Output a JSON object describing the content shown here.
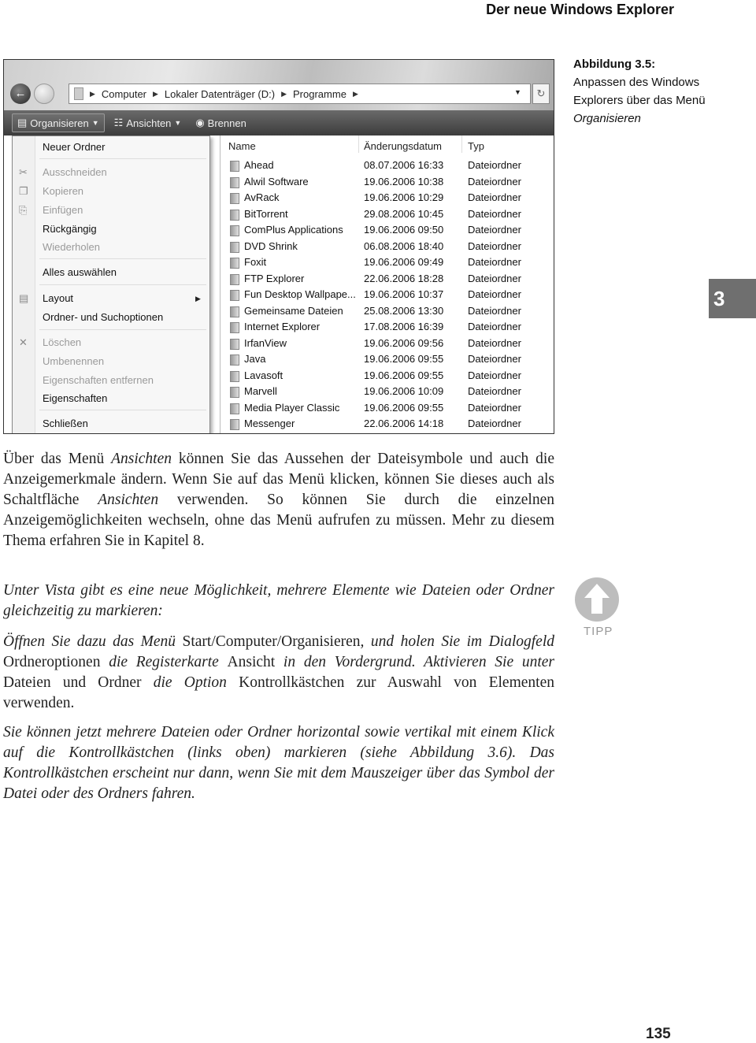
{
  "header": {
    "running_title": "Der neue Windows Explorer"
  },
  "caption": {
    "label": "Abbildung 3.5:",
    "text": "Anpassen des Windows Explorers über das Menü",
    "menu": "Organisieren"
  },
  "chapter_tab": "3",
  "page_number": "135",
  "explorer": {
    "breadcrumb": [
      "Computer",
      "Lokaler Datenträger (D:)",
      "Programme"
    ],
    "toolbar": {
      "organize": "Organisieren",
      "views": "Ansichten",
      "burn": "Brennen"
    },
    "menu": [
      {
        "label": "Neuer Ordner",
        "enabled": true
      },
      {
        "label": "Ausschneiden",
        "enabled": false,
        "icon": "scissors-icon"
      },
      {
        "label": "Kopieren",
        "enabled": false,
        "icon": "copy-icon"
      },
      {
        "label": "Einfügen",
        "enabled": false,
        "icon": "paste-icon"
      },
      {
        "label": "Rückgängig",
        "enabled": true
      },
      {
        "label": "Wiederholen",
        "enabled": false
      },
      {
        "label": "Alles auswählen",
        "enabled": true
      },
      {
        "label": "Layout",
        "enabled": true,
        "icon": "layout-icon",
        "submenu": true
      },
      {
        "label": "Ordner- und Suchoptionen",
        "enabled": true
      },
      {
        "label": "Löschen",
        "enabled": false,
        "icon": "delete-x-icon"
      },
      {
        "label": "Umbenennen",
        "enabled": false
      },
      {
        "label": "Eigenschaften entfernen",
        "enabled": false
      },
      {
        "label": "Eigenschaften",
        "enabled": true
      },
      {
        "label": "Schließen",
        "enabled": true
      }
    ],
    "columns": [
      "Name",
      "Änderungsdatum",
      "Typ"
    ],
    "files": [
      [
        "Ahead",
        "08.07.2006 16:33",
        "Dateiordner"
      ],
      [
        "Alwil Software",
        "19.06.2006 10:38",
        "Dateiordner"
      ],
      [
        "AvRack",
        "19.06.2006 10:29",
        "Dateiordner"
      ],
      [
        "BitTorrent",
        "29.08.2006 10:45",
        "Dateiordner"
      ],
      [
        "ComPlus Applications",
        "19.06.2006 09:50",
        "Dateiordner"
      ],
      [
        "DVD Shrink",
        "06.08.2006 18:40",
        "Dateiordner"
      ],
      [
        "Foxit",
        "19.06.2006 09:49",
        "Dateiordner"
      ],
      [
        "FTP Explorer",
        "22.06.2006 18:28",
        "Dateiordner"
      ],
      [
        "Fun Desktop Wallpape...",
        "19.06.2006 10:37",
        "Dateiordner"
      ],
      [
        "Gemeinsame Dateien",
        "25.08.2006 13:30",
        "Dateiordner"
      ],
      [
        "Internet Explorer",
        "17.08.2006 16:39",
        "Dateiordner"
      ],
      [
        "IrfanView",
        "19.06.2006 09:56",
        "Dateiordner"
      ],
      [
        "Java",
        "19.06.2006 09:55",
        "Dateiordner"
      ],
      [
        "Lavasoft",
        "19.06.2006 09:55",
        "Dateiordner"
      ],
      [
        "Marvell",
        "19.06.2006 10:09",
        "Dateiordner"
      ],
      [
        "Media Player Classic",
        "19.06.2006 09:55",
        "Dateiordner"
      ],
      [
        "Messenger",
        "22.06.2006 14:18",
        "Dateiordner"
      ]
    ]
  },
  "body": {
    "p1": [
      "Über das Menü ",
      "Ansichten",
      " können Sie das Aussehen der Dateisymbole und auch die Anzeigemerkmale ändern. Wenn Sie auf das Menü klicken, können Sie dieses auch als Schaltfläche ",
      "Ansichten",
      " verwenden. So können Sie durch die einzelnen Anzeigemöglichkeiten wechseln, ohne das Menü aufrufen zu müssen. Mehr zu diesem Thema erfahren Sie in Kapitel 8."
    ],
    "tip_label": "TIPP",
    "tip1": "Unter Vista gibt es eine neue Möglichkeit, mehrere Elemente wie Dateien oder Ordner gleichzeitig zu markieren:",
    "tip2": [
      "Öffnen Sie dazu das Menü ",
      "Start/Computer/Organisieren",
      ", und holen Sie im Dialogfeld ",
      "Ordneroptionen",
      " die Registerkarte ",
      "Ansicht",
      " in den Vordergrund. Aktivieren Sie unter ",
      "Dateien und Ordner",
      " die Option ",
      "Kontrollkästchen zur Auswahl von Elementen verwenden."
    ],
    "tip3": "Sie können jetzt mehrere Dateien oder Ordner horizontal sowie vertikal mit einem Klick auf die Kontrollkästchen (links oben) markieren (siehe Abbildung 3.6). Das Kontrollkästchen erscheint nur dann, wenn Sie mit dem Mauszeiger über das Symbol der Datei oder des Ordners fahren."
  }
}
